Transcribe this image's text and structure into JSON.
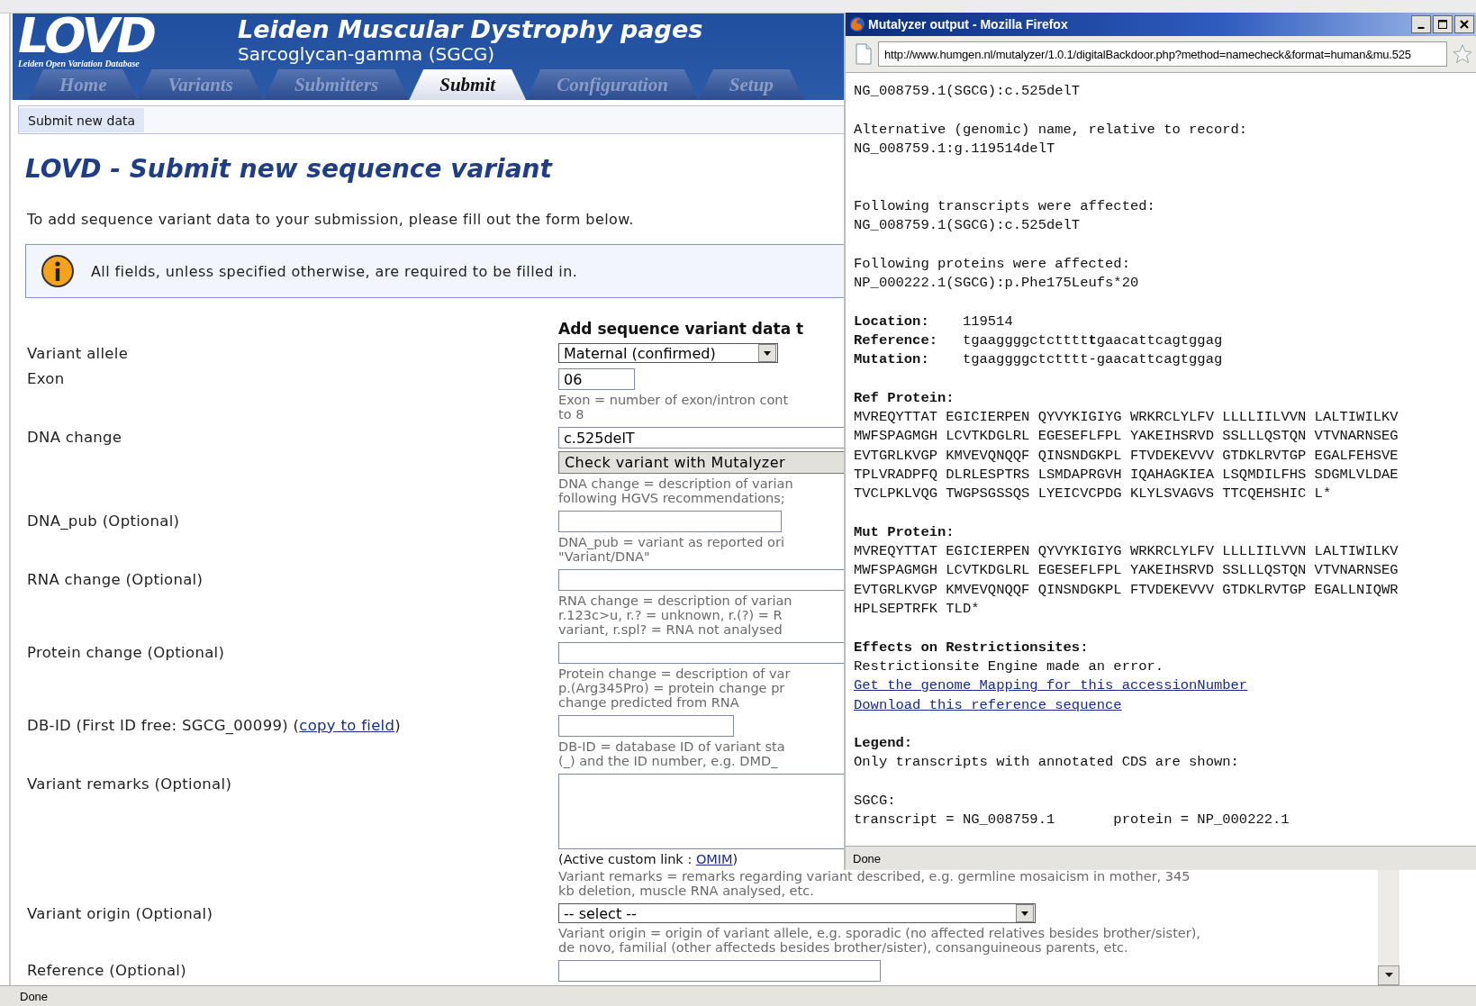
{
  "header": {
    "logo": "LOVD",
    "logo_subtitle": "Leiden Open Variation Database",
    "title": "Leiden Muscular Dystrophy pages",
    "subtitle": "Sarcoglycan-gamma (SGCG)"
  },
  "tabs": [
    {
      "label": "Home",
      "selected": false
    },
    {
      "label": "Variants",
      "selected": false
    },
    {
      "label": "Submitters",
      "selected": false
    },
    {
      "label": "Submit",
      "selected": true
    },
    {
      "label": "Configuration",
      "selected": false
    },
    {
      "label": "Setup",
      "selected": false
    }
  ],
  "breadcrumb": "Submit new data",
  "page_title": "LOVD - Submit new sequence variant",
  "intro": "To add sequence variant data to your submission, please fill out the form below.",
  "notice": "All fields, unless specified otherwise, are required to be filled in.",
  "form": {
    "heading": "Add sequence variant data t",
    "rows": [
      {
        "label": "Variant allele",
        "kind": "select",
        "value": "Maternal (confirmed)"
      },
      {
        "label": "Exon",
        "kind": "input",
        "value": "06",
        "help": [
          "Exon = number of exon/intron cont",
          "to 8"
        ]
      },
      {
        "label": "DNA change",
        "kind": "input",
        "value": "c.525delT",
        "button": "Check variant with Mutalyzer",
        "help": [
          "DNA change = description of varian",
          "following HGVS recommendations;"
        ]
      },
      {
        "label": "DNA_pub (Optional)",
        "kind": "input",
        "help": [
          "DNA_pub = variant as reported ori",
          "\"Variant/DNA\""
        ]
      },
      {
        "label": "RNA change (Optional)",
        "kind": "input",
        "help": [
          "RNA change = description of varian",
          "r.123c>u, r.? = unknown, r.(?) = R",
          "variant, r.spl? = RNA not analysed"
        ]
      },
      {
        "label": "Protein change (Optional)",
        "kind": "input",
        "help": [
          "Protein change = description of var",
          "p.(Arg345Pro) = protein change pr",
          "change predicted from RNA"
        ]
      },
      {
        "label": "DB-ID (First ID free: SGCG_00099) (",
        "label_link": "copy to field",
        "label_after": ")",
        "kind": "input",
        "help": [
          "DB-ID = database ID of variant sta",
          "(_) and the ID number, e.g. DMD_"
        ]
      },
      {
        "label": "Variant remarks (Optional)",
        "kind": "textarea",
        "note": "(Active custom link : ",
        "note_link": "OMIM",
        "note_after": ")",
        "help": [
          "Variant remarks = remarks regarding variant described, e.g. germline mosaicism in mother, 345",
          "kb deletion, muscle RNA analysed, etc."
        ]
      },
      {
        "label": "Variant origin (Optional)",
        "kind": "select",
        "value": "-- select --",
        "help": [
          "Variant origin = origin of variant allele, e.g. sporadic (no affected relatives besides brother/sister),",
          "de novo, familial (other affecteds besides brother/sister), consanguineous parents, etc."
        ]
      },
      {
        "label": "Reference (Optional)",
        "kind": "input"
      }
    ]
  },
  "status_bar": "Done",
  "popup": {
    "title": "Mutalyzer output - Mozilla Firefox",
    "url": "http://www.humgen.nl/mutalyzer/1.0.1/digitalBackdoor.php?method=namecheck&format=human&mu.525",
    "status_bar": "Done",
    "lines": [
      {
        "kind": "text",
        "text": "NG_008759.1(SGCG):c.525delT"
      },
      {
        "kind": "gap"
      },
      {
        "kind": "text",
        "text": "Alternative (genomic) name, relative to record:"
      },
      {
        "kind": "text",
        "text": "NG_008759.1:g.119514delT"
      },
      {
        "kind": "gap"
      },
      {
        "kind": "gap"
      },
      {
        "kind": "text",
        "text": "Following transcripts were affected:"
      },
      {
        "kind": "text",
        "text": "NG_008759.1(SGCG):c.525delT"
      },
      {
        "kind": "gap"
      },
      {
        "kind": "text",
        "text": "Following proteins were affected:"
      },
      {
        "kind": "text",
        "text": "NP_000222.1(SGCG):p.Phe175Leufs*20"
      },
      {
        "kind": "gap"
      },
      {
        "kind": "field",
        "label": "Location:",
        "value": "119514"
      },
      {
        "kind": "field",
        "label": "Reference:",
        "value": "tgaaggggctctttt**t**gaacattcagtggag"
      },
      {
        "kind": "field",
        "label": "Mutation:",
        "value": "tgaaggggctctttt-gaacattcagtggag"
      },
      {
        "kind": "gap"
      },
      {
        "kind": "bold",
        "text": "Ref Protein:"
      },
      {
        "kind": "text",
        "text": "MVREQYTTAT EGICIERPEN QYVYKIGIYG WRKRCLYLFV LLLLIILVVN LALTIWILKV"
      },
      {
        "kind": "text",
        "text": "MWFSPAGMGH LCVTKDGLRL EGESEFLFPL YAKEIHSRVD SSLLLQSTQN VTVNARNSEG"
      },
      {
        "kind": "text",
        "text": "EVTGRLKVGP KMVEVQNQQF QINSNDGKPL FTVDEKEVVV GTDKLRVTGP EGALFEHSVE"
      },
      {
        "kind": "text",
        "text": "TPLVRADPFQ DLRLESPTRS LSMDAPRGVH IQAHAGKIEA LSQMDILFHS SDGMLVLDAE"
      },
      {
        "kind": "text",
        "text": "TVCLPKLVQG TWGPSGSSQS LYEICVCPDG KLYLSVAGVS TTCQEHSHIC L*"
      },
      {
        "kind": "gap"
      },
      {
        "kind": "bold",
        "text": "Mut Protein:"
      },
      {
        "kind": "text",
        "text": "MVREQYTTAT EGICIERPEN QYVYKIGIYG WRKRCLYLFV LLLLIILVVN LALTIWILKV"
      },
      {
        "kind": "text",
        "text": "MWFSPAGMGH LCVTKDGLRL EGESEFLFPL YAKEIHSRVD SSLLLQSTQN VTVNARNSEG"
      },
      {
        "kind": "text",
        "text": "EVTGRLKVGP KMVEVQNQQF QINSNDGKPL FTVDEKEVVV GTDKLRVTGP EGALLNIQWR"
      },
      {
        "kind": "text",
        "text": "HPLSEPTRFK TLD*"
      },
      {
        "kind": "gap"
      },
      {
        "kind": "bold",
        "text": "Effects on Restrictionsites:"
      },
      {
        "kind": "text",
        "text": "Restrictionsite Engine made an error."
      },
      {
        "kind": "link",
        "text": "Get the genome Mapping for this accessionNumber"
      },
      {
        "kind": "link",
        "text": "Download this reference sequence"
      },
      {
        "kind": "gap"
      },
      {
        "kind": "bold",
        "text": "Legend:"
      },
      {
        "kind": "text",
        "text": "Only transcripts with annotated CDS are shown:"
      },
      {
        "kind": "gap"
      },
      {
        "kind": "text",
        "text": "SGCG:"
      },
      {
        "kind": "pair",
        "left": "transcript = NG_008759.1",
        "right": "protein = NP_000222.1"
      }
    ]
  }
}
